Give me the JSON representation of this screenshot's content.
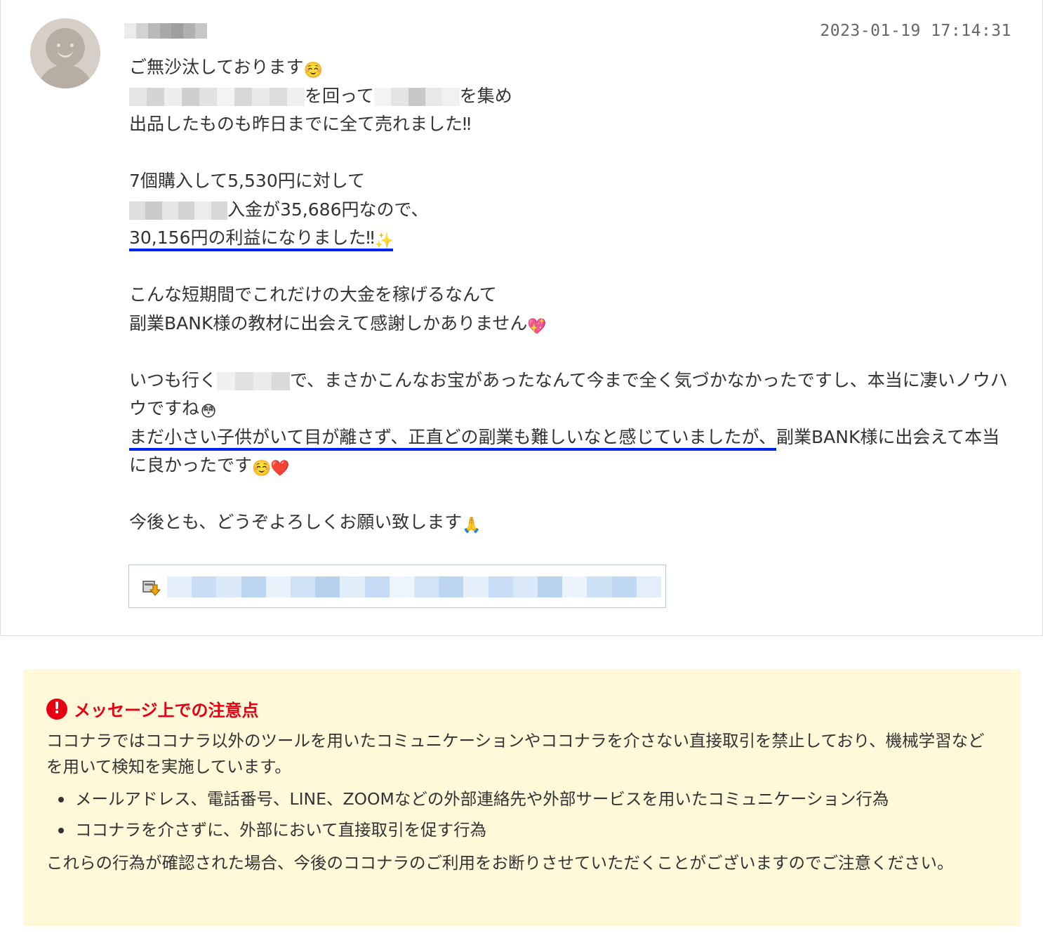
{
  "message": {
    "timestamp": "2023-01-19 17:14:31",
    "lines": {
      "l1": "ご無沙汰しております",
      "l2_a": "を回って",
      "l2_b": "を集め",
      "l3": "出品したものも昨日までに全て売れました‼︎",
      "l4": "7個購入して5,530円に対して",
      "l5": "入金が35,686円なので、",
      "l6": "30,156円の利益になりました‼︎",
      "l7": "こんな短期間でこれだけの大金を稼げるなんて",
      "l8": "副業BANK様の教材に出会えて感謝しかありません",
      "l9_a": "いつも行く",
      "l9_b": "で、まさかこんなお宝があったなんて今まで全く気づかなかったですし、本当に凄いノウハウですね",
      "l10_a": "まだ小さい子供がいて目が離さず、正直どの副業も難しいなと感じていましたが、",
      "l10_b": "副業BANK様に出会えて本当に良かったです",
      "l11": "今後とも、どうぞよろしくお願い致します"
    },
    "emojis": {
      "smile": "☺️",
      "sparkle": "✨",
      "heart_sparkle": "💖",
      "flushed": "😳",
      "red_heart": "❤️",
      "pray": "🙏"
    },
    "highlight_color": "#0022ee"
  },
  "notice": {
    "title": "メッセージ上での注意点",
    "icon": "!",
    "paragraph1": "ココナラではココナラ以外のツールを用いたコミュニケーションやココナラを介さない直接取引を禁止しており、機械学習などを用いて検知を実施しています。",
    "bullets": [
      "メールアドレス、電話番号、LINE、ZOOMなどの外部連絡先や外部サービスを用いたコミュニケーション行為",
      "ココナラを介さずに、外部において直接取引を促す行為"
    ],
    "paragraph2": "これらの行為が確認された場合、今後のココナラのご利用をお断りさせていただくことがございますのでご注意ください。",
    "title_color": "#e60012",
    "background": "#fff9d9"
  }
}
